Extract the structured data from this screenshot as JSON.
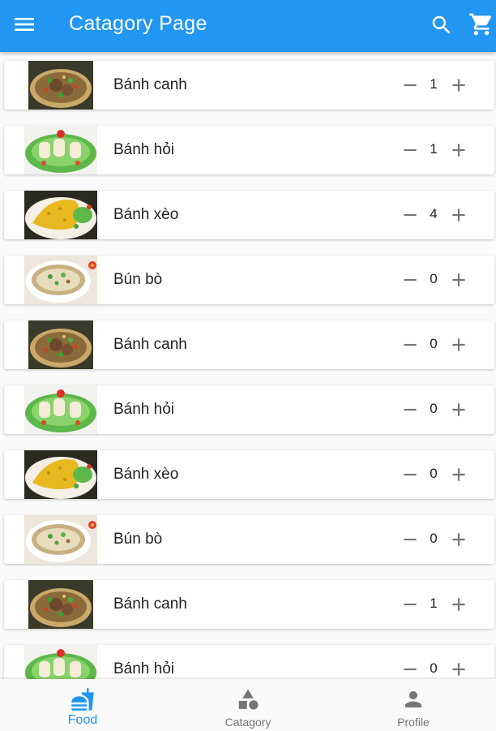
{
  "appbar": {
    "title": "Catagory Page",
    "menu_icon": "menu-icon",
    "search_icon": "search-icon",
    "cart_icon": "cart-icon",
    "color": "#2196f3"
  },
  "items": [
    {
      "name": "Bánh canh",
      "qty": "1",
      "image": "banh-canh"
    },
    {
      "name": "Bánh hỏi",
      "qty": "1",
      "image": "banh-hoi"
    },
    {
      "name": "Bánh xèo",
      "qty": "4",
      "image": "banh-xeo"
    },
    {
      "name": "Bún bò",
      "qty": "0",
      "image": "bun-bo"
    },
    {
      "name": "Bánh canh",
      "qty": "0",
      "image": "banh-canh"
    },
    {
      "name": "Bánh hỏi",
      "qty": "0",
      "image": "banh-hoi"
    },
    {
      "name": "Bánh xèo",
      "qty": "0",
      "image": "banh-xeo"
    },
    {
      "name": "Bún bò",
      "qty": "0",
      "image": "bun-bo"
    },
    {
      "name": "Bánh canh",
      "qty": "1",
      "image": "banh-canh"
    },
    {
      "name": "Bánh hỏi",
      "qty": "0",
      "image": "banh-hoi"
    }
  ],
  "bottom_nav": [
    {
      "label": "Food",
      "icon": "fastfood-icon",
      "active": true
    },
    {
      "label": "Catagory",
      "icon": "category-icon",
      "active": false
    },
    {
      "label": "Profile",
      "icon": "person-icon",
      "active": false
    }
  ],
  "colors": {
    "accent": "#2196f3",
    "inactive": "#757575"
  }
}
